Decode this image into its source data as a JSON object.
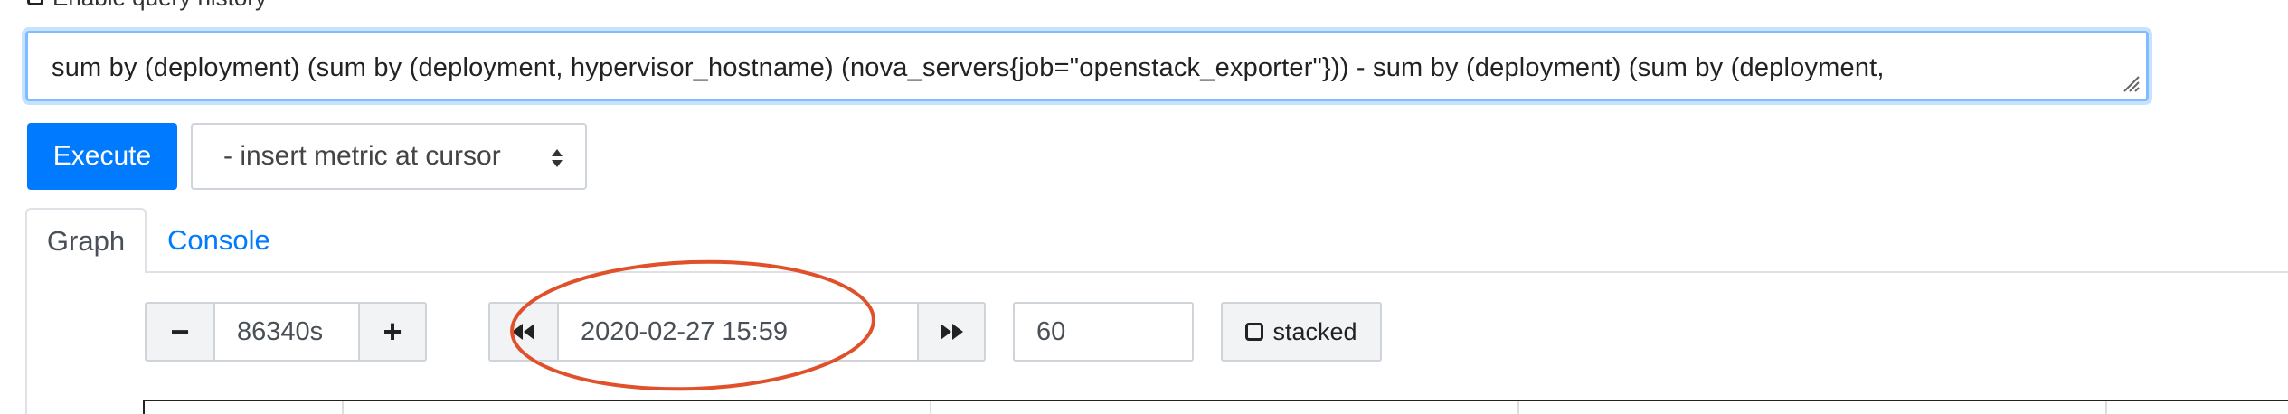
{
  "history": {
    "label": "Enable query history"
  },
  "query": {
    "value": "sum by (deployment) (sum by (deployment, hypervisor_hostname) (nova_servers{job=\"openstack_exporter\"})) - sum by (deployment) (sum by (deployment,"
  },
  "toolbar": {
    "execute_label": "Execute",
    "metric_select_label": "- insert metric at cursor"
  },
  "tabs": [
    {
      "label": "Graph",
      "active": true
    },
    {
      "label": "Console",
      "active": false
    }
  ],
  "graph_controls": {
    "range_minus": "−",
    "range_value": "86340s",
    "range_plus": "+",
    "end_time": "2020-02-27 15:59",
    "resolution": "60",
    "stacked_label": "stacked"
  },
  "colors": {
    "accent": "#007bff",
    "annotation": "#e0512b"
  },
  "icons": {
    "back": "fast-backward-icon",
    "forward": "fast-forward-icon",
    "caret": "sort-caret-icon",
    "checkbox": "checkbox-icon"
  }
}
